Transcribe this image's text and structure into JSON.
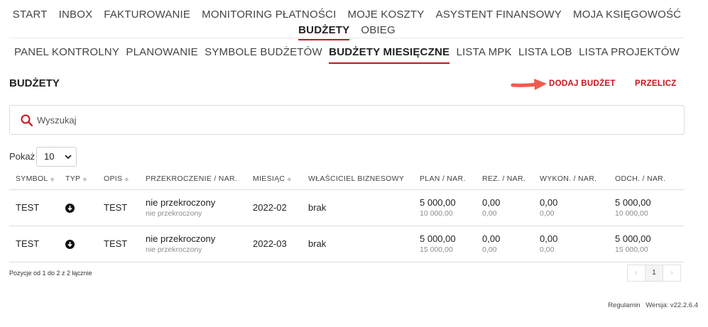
{
  "topnav": {
    "row1": [
      "START",
      "INBOX",
      "FAKTUROWANIE",
      "MONITORING PŁATNOŚCI",
      "MOJE KOSZTY",
      "ASYSTENT FINANSOWY",
      "MOJA KSIĘGOWOŚĆ"
    ],
    "row2": [
      "BUDŻETY",
      "OBIEG"
    ],
    "active": "BUDŻETY"
  },
  "subnav": {
    "items": [
      "PANEL KONTROLNY",
      "PLANOWANIE",
      "SYMBOLE BUDŻETÓW",
      "BUDŻETY MIESIĘCZNE",
      "LISTA MPK",
      "LISTA LOB",
      "LISTA PROJEKTÓW"
    ],
    "active": "BUDŻETY MIESIĘCZNE"
  },
  "page": {
    "title": "BUDŻETY",
    "add_label": "DODAJ BUDŻET",
    "recalc_label": "PRZELICZ"
  },
  "search": {
    "placeholder": "Wyszukaj",
    "value": ""
  },
  "page_size": {
    "label": "Pokaż",
    "value": "10"
  },
  "table": {
    "headers": [
      "SYMBOL",
      "TYP",
      "OPIS",
      "PRZEKROCZENIE / NAR.",
      "MIESIĄC",
      "WŁAŚCICIEL BIZNESOWY",
      "PLAN / NAR.",
      "REZ. / NAR.",
      "WYKON. / NAR.",
      "ODCH. / NAR."
    ],
    "rows": [
      {
        "symbol": "TEST",
        "typ_icon": "arrow-down-circle-icon",
        "opis": "TEST",
        "przekroczenie": "nie przekroczony",
        "przekroczenie_nar": "nie przekroczony",
        "miesiac": "2022-02",
        "wlasciciel": "brak",
        "plan": "5 000,00",
        "plan_nar": "10 000,00",
        "rez": "0,00",
        "rez_nar": "0,00",
        "wykon": "0,00",
        "wykon_nar": "0,00",
        "odch": "5 000,00",
        "odch_nar": "10 000,00"
      },
      {
        "symbol": "TEST",
        "typ_icon": "arrow-down-circle-icon",
        "opis": "TEST",
        "przekroczenie": "nie przekroczony",
        "przekroczenie_nar": "nie przekroczony",
        "miesiac": "2022-03",
        "wlasciciel": "brak",
        "plan": "5 000,00",
        "plan_nar": "15 000,00",
        "rez": "0,00",
        "rez_nar": "0,00",
        "wykon": "0,00",
        "wykon_nar": "0,00",
        "odch": "5 000,00",
        "odch_nar": "15 000,00"
      }
    ]
  },
  "pagination": {
    "info": "Pozycje od 1 do 2 z 2 łącznie",
    "prev": "‹",
    "current": "1",
    "next": "›"
  },
  "footer": {
    "terms": "Regulamin",
    "version": "Wersja: v22.2.6.4"
  },
  "colors": {
    "accent": "#c4161c",
    "arrow": "#f05a4f"
  }
}
